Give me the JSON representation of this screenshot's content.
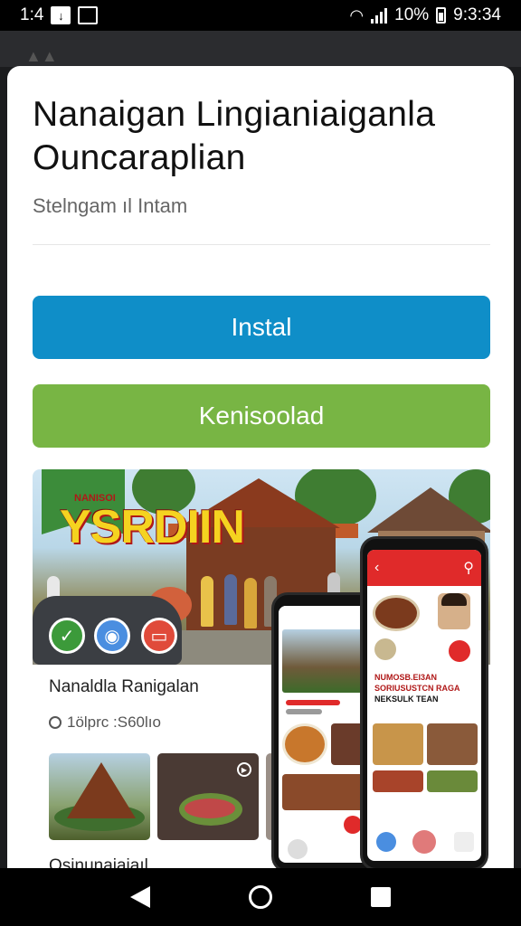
{
  "status_bar": {
    "time_left": "1:4",
    "battery_percent": "10%",
    "clock": "9:3:34",
    "icons": [
      "download-icon",
      "screen-icon",
      "wifi-icon",
      "signal-icon",
      "battery-icon"
    ]
  },
  "dialog": {
    "title_line1": "Nanaigan Lingianiaiganla",
    "title_line2": "Ouncaraplian",
    "subtitle": "Stelngam  ıl  Intam",
    "install_label": "Instal",
    "secondary_label": "Kenisoolad",
    "colors": {
      "install": "#0f8ec8",
      "secondary": "#78b544",
      "accent_red": "#e02a2a"
    }
  },
  "preview": {
    "banner_text": "YSRDIIN",
    "banner_small": "NANISOI",
    "app_title": "Nanaldla Ranigalan",
    "meta": "1ölprc :S60lıo",
    "footer": "Osinunaiaiaıl",
    "phone_front": {
      "text_line1": "NUMOSB.EI3AN",
      "text_line2": "SORIUSUSTCN RAGA",
      "text_line3": "NEKSULK TEAN"
    }
  },
  "nav_bar": {
    "icons": [
      "back-icon",
      "home-icon",
      "recents-icon"
    ]
  }
}
